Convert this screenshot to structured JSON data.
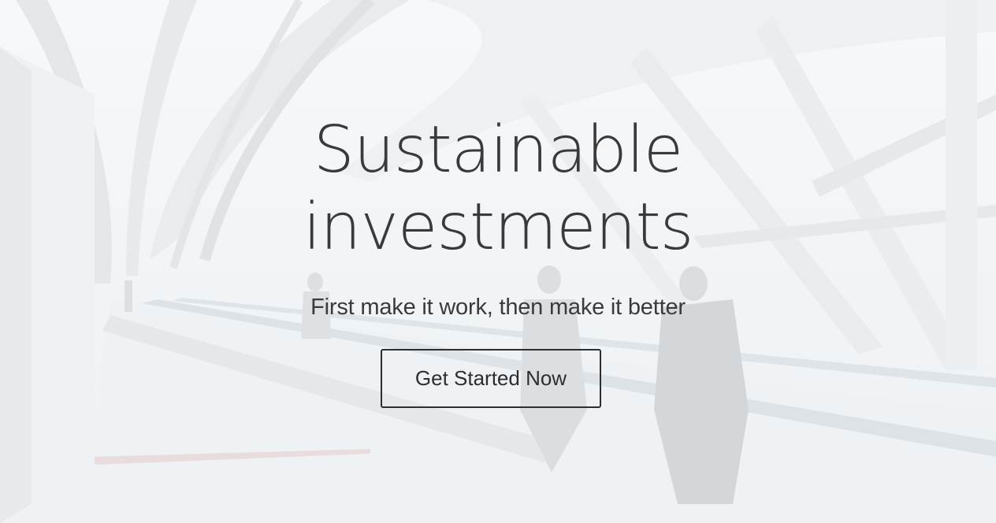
{
  "hero": {
    "title_line1": "Sustainable",
    "title_line2": "investments",
    "subtitle": "First make it work, then make it better",
    "cta_label": "Get Started Now",
    "background_image": "airport-walkway-photo"
  },
  "colors": {
    "text": "#3a3a3a",
    "button_border": "#2e2e2e",
    "background": "#f4f6f8"
  }
}
